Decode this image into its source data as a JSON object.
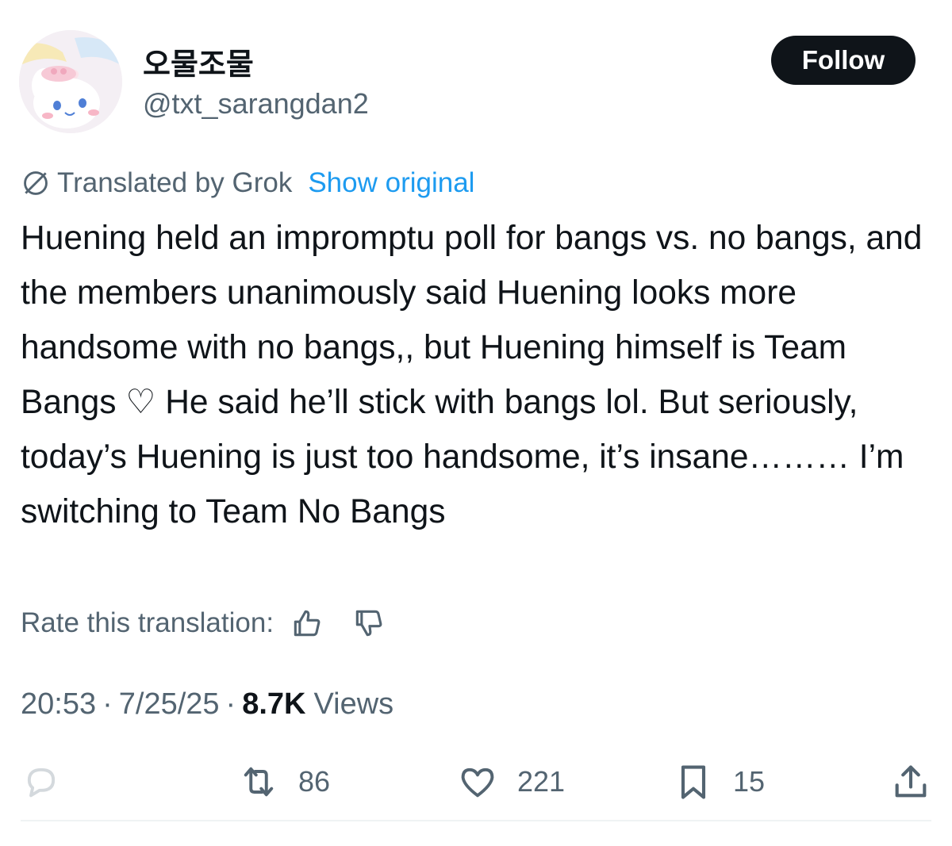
{
  "author": {
    "display_name": "오물조물",
    "handle": "@txt_sarangdan2",
    "avatar": "cinnamoroll-avatar"
  },
  "follow_button": {
    "label": "Follow"
  },
  "translation": {
    "icon": "globe-icon",
    "label": "Translated by Grok",
    "show_original": "Show original"
  },
  "tweet": {
    "text": "Huening held an impromptu poll for bangs vs. no bangs, and the members unanimously said Huening looks more handsome with no bangs,, but Huening himself is Team Bangs ♡ He said he’ll stick with bangs lol. But seriously, today’s Huening is just too handsome, it’s insane……… I’m switching to Team No Bangs"
  },
  "rate": {
    "label": "Rate this translation:",
    "icons": [
      "thumbs-up-icon",
      "thumbs-down-icon"
    ]
  },
  "meta": {
    "time": "20:53",
    "date": "7/25/25",
    "separator": "·",
    "views_count": "8.7K",
    "views_label": "Views"
  },
  "actions": {
    "reply": {
      "icon": "reply-icon",
      "count": ""
    },
    "repost": {
      "icon": "repost-icon",
      "count": "86"
    },
    "like": {
      "icon": "heart-icon",
      "count": "221"
    },
    "bookmark": {
      "icon": "bookmark-icon",
      "count": "15"
    },
    "share": {
      "icon": "share-icon"
    }
  },
  "colors": {
    "text_primary": "#0f1419",
    "text_secondary": "#536471",
    "link": "#1d9bf0",
    "button_bg": "#0f1419",
    "divider": "#eff3f4"
  }
}
